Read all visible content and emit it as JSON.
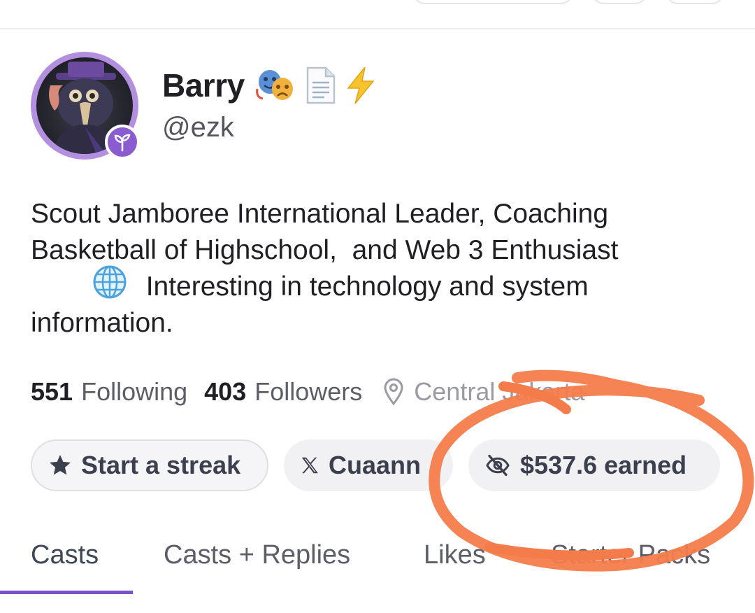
{
  "profile": {
    "display_name": "Barry",
    "name_emojis": [
      "theater-masks-emoji",
      "document-emoji",
      "lightning-emoji"
    ],
    "username": "@ezk",
    "badge_icon": "sprout-icon"
  },
  "bio": {
    "line1": "Scout Jamboree International Leader, Coaching",
    "line2": "Basketball of Highschool,  and Web 3 Enthusiast",
    "line3": "Interesting in technology and system",
    "line4": "information."
  },
  "stats": {
    "following_count": "551",
    "following_label": "Following",
    "followers_count": "403",
    "followers_label": "Followers",
    "location": "Central Jakarta"
  },
  "chips": {
    "streak_label": "Start a streak",
    "x_label": "Cuaann",
    "earned_label": "$537.6 earned"
  },
  "tabs": {
    "casts": "Casts",
    "casts_replies": "Casts + Replies",
    "likes": "Likes",
    "starter_packs": "Starter Packs"
  },
  "colors": {
    "accent": "#7b52c8",
    "avatar_ring": "#b38fe0",
    "annotation": "#f47c4a"
  }
}
